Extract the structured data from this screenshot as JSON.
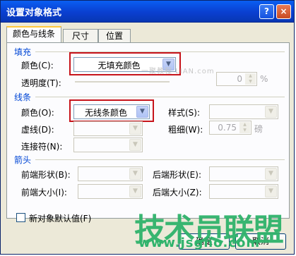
{
  "window": {
    "title": "设置对象格式",
    "help_label": "?",
    "close_label": "×"
  },
  "tabs": [
    {
      "label": "颜色与线条"
    },
    {
      "label": "尺寸"
    },
    {
      "label": "位置"
    }
  ],
  "fill": {
    "section_label": "填充",
    "color_label": "颜色(C):",
    "color_value": "无填充颜色",
    "transparency_label": "透明度(T):",
    "transparency_value": "0",
    "transparency_unit": "%"
  },
  "line": {
    "section_label": "线条",
    "color_label": "颜色(O):",
    "color_value": "无线条颜色",
    "style_label": "样式(S):",
    "dash_label": "虚线(D):",
    "weight_label": "粗细(W):",
    "weight_value": "0.75",
    "weight_unit": "磅",
    "connector_label": "连接符(N):"
  },
  "arrows": {
    "section_label": "箭头",
    "begin_style_label": "前端形状(B):",
    "end_style_label": "后端形状(E):",
    "begin_size_label": "前端大小(I):",
    "end_size_label": "后端大小(Z):"
  },
  "default_checkbox_label": "新对象默认值(F)",
  "buttons": {
    "ok_label": "确定",
    "cancel_label": "取消"
  },
  "overlay": {
    "watermark_text": "技术员联盟",
    "watermark_url": "www.jsgho.com",
    "faint_text": "一聚教程 LIAN.com"
  },
  "colors": {
    "titlebar": "#0a3fd0",
    "section_label": "#0046d5",
    "highlight": "#c7141b",
    "watermark": "#2fb36b"
  }
}
